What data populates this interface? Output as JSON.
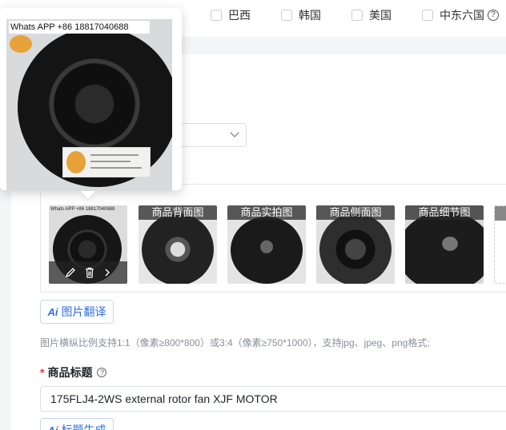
{
  "countries": [
    {
      "label": "巴西",
      "checked": false
    },
    {
      "label": "韩国",
      "checked": false
    },
    {
      "label": "美国",
      "checked": false
    },
    {
      "label": "中东六国",
      "checked": false,
      "has_help": true
    }
  ],
  "popover": {
    "watermark": "Whats APP +86 18817040688"
  },
  "images": {
    "thumbs": [
      {
        "label": "",
        "watermark": "Whats APP +86 18817040688",
        "has_actions": true
      },
      {
        "label": "商品背面图"
      },
      {
        "label": "商品实拍图"
      },
      {
        "label": "商品侧面图"
      },
      {
        "label": "商品细节图"
      }
    ],
    "translate_button": "图片翻译",
    "hint": "图片横纵比例支持1:1（像素≥800*800）或3:4（像素≥750*1000），支持jpg、jpeg、png格式;"
  },
  "title_field": {
    "label": "商品标题",
    "value": "175FLJ4-2WS external rotor fan XJF MOTOR",
    "generate_button": "标题生成"
  },
  "icons": {
    "help": "question-circle-icon",
    "edit": "edit-icon",
    "delete": "trash-icon",
    "next": "chevron-right-icon",
    "ai": "ai-icon",
    "dropdown": "chevron-down-icon"
  },
  "colors": {
    "accent": "#2f6fe4",
    "required": "#e4393c"
  }
}
